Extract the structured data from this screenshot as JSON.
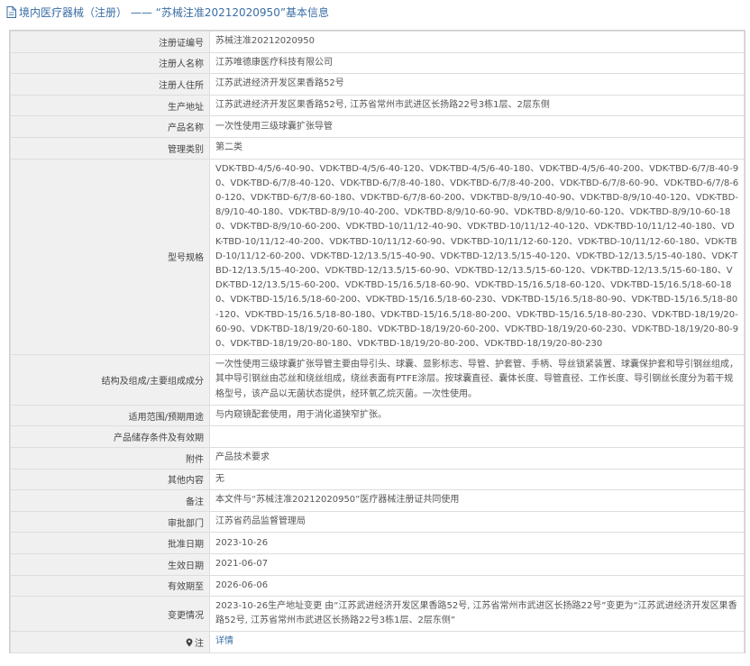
{
  "header": {
    "title": "境内医疗器械（注册） —— “苏械注准20212020950”基本信息"
  },
  "rows": [
    {
      "label": "注册证编号",
      "value": "苏械注准20212020950"
    },
    {
      "label": "注册人名称",
      "value": "江苏唯德康医疗科技有限公司"
    },
    {
      "label": "注册人住所",
      "value": "江苏武进经济开发区果香路52号"
    },
    {
      "label": "生产地址",
      "value": "江苏武进经济开发区果香路52号, 江苏省常州市武进区长扬路22号3栋1层、2层东侧"
    },
    {
      "label": "产品名称",
      "value": "一次性使用三级球囊扩张导管"
    },
    {
      "label": "管理类别",
      "value": "第二类"
    },
    {
      "label": "型号规格",
      "value": "VDK-TBD-4/5/6-40-90、VDK-TBD-4/5/6-40-120、VDK-TBD-4/5/6-40-180、VDK-TBD-4/5/6-40-200、VDK-TBD-6/7/8-40-90、VDK-TBD-6/7/8-40-120、VDK-TBD-6/7/8-40-180、VDK-TBD-6/7/8-40-200、VDK-TBD-6/7/8-60-90、VDK-TBD-6/7/8-60-120、VDK-TBD-6/7/8-60-180、VDK-TBD-6/7/8-60-200、VDK-TBD-8/9/10-40-90、VDK-TBD-8/9/10-40-120、VDK-TBD-8/9/10-40-180、VDK-TBD-8/9/10-40-200、VDK-TBD-8/9/10-60-90、VDK-TBD-8/9/10-60-120、VDK-TBD-8/9/10-60-180、VDK-TBD-8/9/10-60-200、VDK-TBD-10/11/12-40-90、VDK-TBD-10/11/12-40-120、VDK-TBD-10/11/12-40-180、VDK-TBD-10/11/12-40-200、VDK-TBD-10/11/12-60-90、VDK-TBD-10/11/12-60-120、VDK-TBD-10/11/12-60-180、VDK-TBD-10/11/12-60-200、VDK-TBD-12/13.5/15-40-90、VDK-TBD-12/13.5/15-40-120、VDK-TBD-12/13.5/15-40-180、VDK-TBD-12/13.5/15-40-200、VDK-TBD-12/13.5/15-60-90、VDK-TBD-12/13.5/15-60-120、VDK-TBD-12/13.5/15-60-180、VDK-TBD-12/13.5/15-60-200、VDK-TBD-15/16.5/18-60-90、VDK-TBD-15/16.5/18-60-120、VDK-TBD-15/16.5/18-60-180、VDK-TBD-15/16.5/18-60-200、VDK-TBD-15/16.5/18-60-230、VDK-TBD-15/16.5/18-80-90、VDK-TBD-15/16.5/18-80-120、VDK-TBD-15/16.5/18-80-180、VDK-TBD-15/16.5/18-80-200、VDK-TBD-15/16.5/18-80-230、VDK-TBD-18/19/20-60-90、VDK-TBD-18/19/20-60-180、VDK-TBD-18/19/20-60-200、VDK-TBD-18/19/20-60-230、VDK-TBD-18/19/20-80-90、VDK-TBD-18/19/20-80-180、VDK-TBD-18/19/20-80-200、VDK-TBD-18/19/20-80-230"
    },
    {
      "label": "结构及组成/主要组成成分",
      "value": "一次性使用三级球囊扩张导管主要由导引头、球囊、显影标志、导管、护套管、手柄、导丝锁紧装置、球囊保护套和导引钢丝组成，其中导引钢丝由芯丝和绕丝组成，绕丝表面有PTFE涂层。按球囊直径、囊体长度、导管直径、工作长度、导引钢丝长度分为若干规格型号，该产品以无菌状态提供，经环氧乙烷灭菌。一次性使用。"
    },
    {
      "label": "适用范围/预期用途",
      "value": "与内窥镜配套使用，用于消化道狭窄扩张。"
    },
    {
      "label": "产品储存条件及有效期",
      "value": ""
    },
    {
      "label": "附件",
      "value": "产品技术要求"
    },
    {
      "label": "其他内容",
      "value": "无"
    },
    {
      "label": "备注",
      "value": "本文件与“苏械注准20212020950”医疗器械注册证共同使用"
    },
    {
      "label": "审批部门",
      "value": "江苏省药品监督管理局"
    },
    {
      "label": "批准日期",
      "value": "2023-10-26"
    },
    {
      "label": "生效日期",
      "value": "2021-06-07"
    },
    {
      "label": "有效期至",
      "value": "2026-06-06"
    },
    {
      "label": "变更情况",
      "value": "2023-10-26生产地址变更 由“江苏武进经济开发区果香路52号, 江苏省常州市武进区长扬路22号”变更为“江苏武进经济开发区果香路52号, 江苏省常州市武进区长扬路22号3栋1层、2层东侧”"
    }
  ],
  "footer": {
    "label": "注",
    "link": "详情"
  },
  "colors": {
    "accent": "#3a6ea5",
    "label_bg": "#f0f0f0",
    "border": "#dddddd"
  }
}
